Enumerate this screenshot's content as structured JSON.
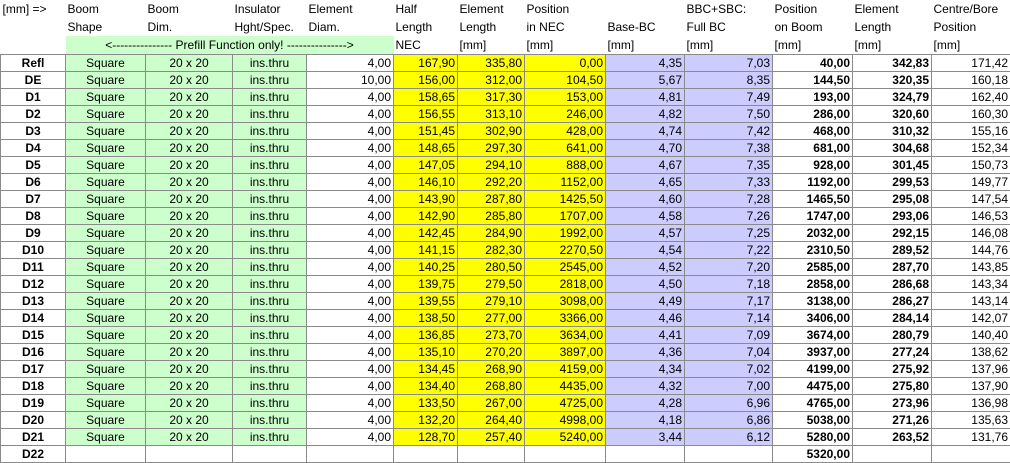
{
  "sheet": {
    "units_label": "[mm] =>",
    "prefill_note": "<--------------- Prefill Function only! --------------->",
    "headers": [
      [
        "",
        "Boom",
        "Boom",
        "Insulator",
        "Element",
        "Half",
        "Element",
        "Position",
        "",
        "BBC+SBC:",
        "Position",
        "Element",
        "Centre/Bore"
      ],
      [
        "",
        "Shape",
        "Dim.",
        "Hght/Spec.",
        "Diam.",
        "Length",
        "Length",
        "in NEC",
        "Base-BC",
        "Full BC",
        "on Boom",
        "Length",
        "Position"
      ],
      [
        "",
        "",
        "",
        "",
        "",
        "NEC",
        "[mm]",
        "[mm]",
        "[mm]",
        "[mm]",
        "[mm]",
        "[mm]",
        "[mm]"
      ]
    ],
    "rows": [
      [
        "Refl",
        "Square",
        "20 x 20",
        "ins.thru",
        "4,00",
        "167,90",
        "335,80",
        "0,00",
        "4,35",
        "7,03",
        "40,00",
        "342,83",
        "171,42"
      ],
      [
        "DE",
        "Square",
        "20 x 20",
        "ins.thru",
        "10,00",
        "156,00",
        "312,00",
        "104,50",
        "5,67",
        "8,35",
        "144,50",
        "320,35",
        "160,18"
      ],
      [
        "D1",
        "Square",
        "20 x 20",
        "ins.thru",
        "4,00",
        "158,65",
        "317,30",
        "153,00",
        "4,81",
        "7,49",
        "193,00",
        "324,79",
        "162,40"
      ],
      [
        "D2",
        "Square",
        "20 x 20",
        "ins.thru",
        "4,00",
        "156,55",
        "313,10",
        "246,00",
        "4,82",
        "7,50",
        "286,00",
        "320,60",
        "160,30"
      ],
      [
        "D3",
        "Square",
        "20 x 20",
        "ins.thru",
        "4,00",
        "151,45",
        "302,90",
        "428,00",
        "4,74",
        "7,42",
        "468,00",
        "310,32",
        "155,16"
      ],
      [
        "D4",
        "Square",
        "20 x 20",
        "ins.thru",
        "4,00",
        "148,65",
        "297,30",
        "641,00",
        "4,70",
        "7,38",
        "681,00",
        "304,68",
        "152,34"
      ],
      [
        "D5",
        "Square",
        "20 x 20",
        "ins.thru",
        "4,00",
        "147,05",
        "294,10",
        "888,00",
        "4,67",
        "7,35",
        "928,00",
        "301,45",
        "150,73"
      ],
      [
        "D6",
        "Square",
        "20 x 20",
        "ins.thru",
        "4,00",
        "146,10",
        "292,20",
        "1152,00",
        "4,65",
        "7,33",
        "1192,00",
        "299,53",
        "149,77"
      ],
      [
        "D7",
        "Square",
        "20 x 20",
        "ins.thru",
        "4,00",
        "143,90",
        "287,80",
        "1425,50",
        "4,60",
        "7,28",
        "1465,50",
        "295,08",
        "147,54"
      ],
      [
        "D8",
        "Square",
        "20 x 20",
        "ins.thru",
        "4,00",
        "142,90",
        "285,80",
        "1707,00",
        "4,58",
        "7,26",
        "1747,00",
        "293,06",
        "146,53"
      ],
      [
        "D9",
        "Square",
        "20 x 20",
        "ins.thru",
        "4,00",
        "142,45",
        "284,90",
        "1992,00",
        "4,57",
        "7,25",
        "2032,00",
        "292,15",
        "146,08"
      ],
      [
        "D10",
        "Square",
        "20 x 20",
        "ins.thru",
        "4,00",
        "141,15",
        "282,30",
        "2270,50",
        "4,54",
        "7,22",
        "2310,50",
        "289,52",
        "144,76"
      ],
      [
        "D11",
        "Square",
        "20 x 20",
        "ins.thru",
        "4,00",
        "140,25",
        "280,50",
        "2545,00",
        "4,52",
        "7,20",
        "2585,00",
        "287,70",
        "143,85"
      ],
      [
        "D12",
        "Square",
        "20 x 20",
        "ins.thru",
        "4,00",
        "139,75",
        "279,50",
        "2818,00",
        "4,50",
        "7,18",
        "2858,00",
        "286,68",
        "143,34"
      ],
      [
        "D13",
        "Square",
        "20 x 20",
        "ins.thru",
        "4,00",
        "139,55",
        "279,10",
        "3098,00",
        "4,49",
        "7,17",
        "3138,00",
        "286,27",
        "143,14"
      ],
      [
        "D14",
        "Square",
        "20 x 20",
        "ins.thru",
        "4,00",
        "138,50",
        "277,00",
        "3366,00",
        "4,46",
        "7,14",
        "3406,00",
        "284,14",
        "142,07"
      ],
      [
        "D15",
        "Square",
        "20 x 20",
        "ins.thru",
        "4,00",
        "136,85",
        "273,70",
        "3634,00",
        "4,41",
        "7,09",
        "3674,00",
        "280,79",
        "140,40"
      ],
      [
        "D16",
        "Square",
        "20 x 20",
        "ins.thru",
        "4,00",
        "135,10",
        "270,20",
        "3897,00",
        "4,36",
        "7,04",
        "3937,00",
        "277,24",
        "138,62"
      ],
      [
        "D17",
        "Square",
        "20 x 20",
        "ins.thru",
        "4,00",
        "134,45",
        "268,90",
        "4159,00",
        "4,34",
        "7,02",
        "4199,00",
        "275,92",
        "137,96"
      ],
      [
        "D18",
        "Square",
        "20 x 20",
        "ins.thru",
        "4,00",
        "134,40",
        "268,80",
        "4435,00",
        "4,32",
        "7,00",
        "4475,00",
        "275,80",
        "137,90"
      ],
      [
        "D19",
        "Square",
        "20 x 20",
        "ins.thru",
        "4,00",
        "133,50",
        "267,00",
        "4725,00",
        "4,28",
        "6,96",
        "4765,00",
        "273,96",
        "136,98"
      ],
      [
        "D20",
        "Square",
        "20 x 20",
        "ins.thru",
        "4,00",
        "132,20",
        "264,40",
        "4998,00",
        "4,18",
        "6,86",
        "5038,00",
        "271,26",
        "135,63"
      ],
      [
        "D21",
        "Square",
        "20 x 20",
        "ins.thru",
        "4,00",
        "128,70",
        "257,40",
        "5240,00",
        "3,44",
        "6,12",
        "5280,00",
        "263,52",
        "131,76"
      ],
      [
        "D22",
        "",
        "",
        "",
        "",
        "",
        "",
        "",
        "",
        "",
        "5320,00",
        "",
        ""
      ]
    ],
    "colors": {
      "prefill_green": "#ccffcc",
      "highlight_yellow": "#ffff00",
      "calc_lavender": "#ccccff",
      "grid": "#8a8a8a"
    }
  }
}
